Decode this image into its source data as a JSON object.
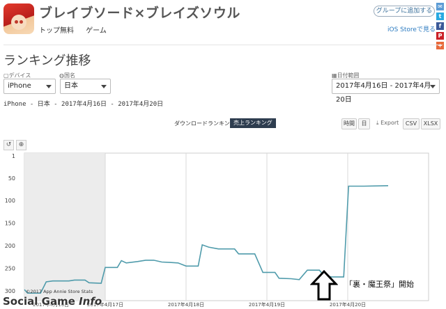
{
  "app": {
    "title": "ブレイブソード×ブレイズソウル",
    "meta": [
      "トップ無料",
      "ゲーム"
    ],
    "group_button": "グループに追加する",
    "store_link": "iOS Storeで見る"
  },
  "social": [
    {
      "name": "share-icon",
      "glyph": "✉",
      "color": "#5b9bd5"
    },
    {
      "name": "twitter-icon",
      "glyph": "t",
      "color": "#29a9e1"
    },
    {
      "name": "facebook-icon",
      "glyph": "f",
      "color": "#3b5998"
    },
    {
      "name": "pinterest-icon",
      "glyph": "P",
      "color": "#cb2027"
    },
    {
      "name": "plus-icon",
      "glyph": "+",
      "color": "#e86a3c"
    }
  ],
  "page": {
    "title": "ランキング推移",
    "subtitle": "iPhone - 日本 - 2017年4月16日 - 2017年4月20日"
  },
  "filters": {
    "device_label": "デバイス",
    "device_value": "iPhone",
    "country_label": "国名",
    "country_value": "日本",
    "date_label": "日付範囲",
    "date_value": "2017年4月16日 - 2017年4月20日"
  },
  "tabs": {
    "download": "ダウンロードランキング",
    "sales": "売上ランキング"
  },
  "toolbar": {
    "hour": "時間",
    "day": "日",
    "export": "Export",
    "csv": "CSV",
    "xlsx": "XLSX"
  },
  "chart_data": {
    "type": "line",
    "ylim": [
      1,
      300
    ],
    "y_reversed": true,
    "yticks": [
      1,
      50,
      100,
      150,
      200,
      250,
      300
    ],
    "xticks": [
      "2017年4月16日",
      "2017年4月17日",
      "2017年4月18日",
      "2017年4月19日",
      "2017年4月20日"
    ],
    "grid": true,
    "line_color": "#4f9bab",
    "credit": "©2017 App Annie Store Stats",
    "points": [
      [
        0.0,
        297
      ],
      [
        0.04,
        305
      ],
      [
        0.2,
        305
      ],
      [
        0.27,
        280
      ],
      [
        0.35,
        278
      ],
      [
        0.55,
        278
      ],
      [
        0.62,
        276
      ],
      [
        0.75,
        276
      ],
      [
        0.8,
        282
      ],
      [
        0.95,
        283
      ],
      [
        1.0,
        248
      ],
      [
        1.15,
        248
      ],
      [
        1.2,
        233
      ],
      [
        1.26,
        238
      ],
      [
        1.4,
        235
      ],
      [
        1.5,
        232
      ],
      [
        1.6,
        232
      ],
      [
        1.7,
        236
      ],
      [
        1.8,
        237
      ],
      [
        1.9,
        238
      ],
      [
        2.0,
        245
      ],
      [
        2.15,
        245
      ],
      [
        2.2,
        198
      ],
      [
        2.28,
        203
      ],
      [
        2.4,
        207
      ],
      [
        2.6,
        207
      ],
      [
        2.65,
        218
      ],
      [
        2.85,
        218
      ],
      [
        2.95,
        259
      ],
      [
        3.1,
        259
      ],
      [
        3.15,
        272
      ],
      [
        3.3,
        273
      ],
      [
        3.4,
        275
      ],
      [
        3.5,
        254
      ],
      [
        3.65,
        254
      ],
      [
        3.7,
        265
      ],
      [
        3.8,
        269
      ],
      [
        3.95,
        269
      ],
      [
        4.01,
        68
      ],
      [
        4.2,
        68
      ],
      [
        4.5,
        67
      ]
    ]
  },
  "annotation": {
    "text": "「裏・魔王祭」開始"
  },
  "watermark": {
    "text": "Social Game ",
    "emphasis": "Info"
  }
}
